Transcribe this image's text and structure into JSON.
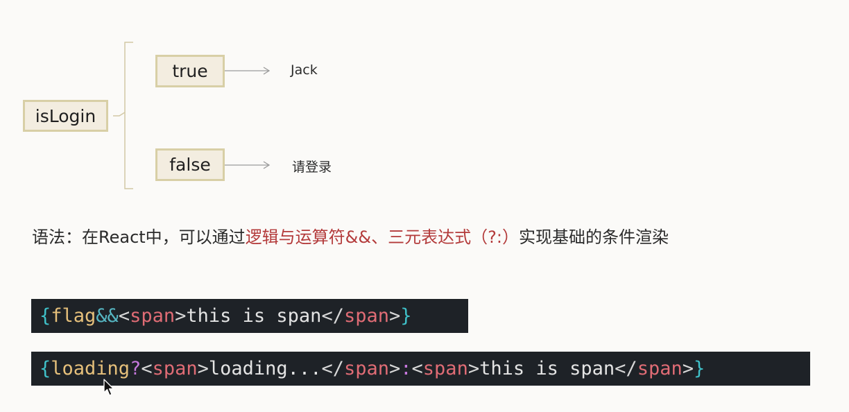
{
  "diagram": {
    "root": "isLogin",
    "branches": [
      {
        "condition": "true",
        "result": "Jack"
      },
      {
        "condition": "false",
        "result": "请登录"
      }
    ]
  },
  "syntax": {
    "prefix": "语法：在React中，可以通过",
    "highlight": "逻辑与运算符&&、三元表达式（?:）",
    "suffix": "实现基础的条件渲染",
    "highlight_color": "#b33a3a"
  },
  "code": {
    "line1": {
      "brace_open": "{",
      "var": "flag",
      "op": "&&",
      "lt1": "<",
      "tag1": "span",
      "gt1": ">",
      "text": "this is span",
      "lt2": "</",
      "tag2": "span",
      "gt2": ">",
      "brace_close": "}"
    },
    "line2": {
      "brace_open": "{",
      "var": "loading",
      "q": "?",
      "a_lt1": "<",
      "a_tag1": "span",
      "a_gt1": ">",
      "a_text": "loading...",
      "a_lt2": "</",
      "a_tag2": "span",
      "a_gt2": ">",
      "colon": ":",
      "b_lt1": "<",
      "b_tag1": "span",
      "b_gt1": ">",
      "b_text": "this is span",
      "b_lt2": "</",
      "b_tag2": "span",
      "b_gt2": ">",
      "brace_close": "}"
    }
  },
  "icons": {
    "cursor": "mouse-pointer-icon"
  },
  "colors": {
    "background": "#fbfaf8",
    "box_fill": "#f3ede0",
    "box_border": "#d8cfa6",
    "code_bg": "#1e2227"
  }
}
